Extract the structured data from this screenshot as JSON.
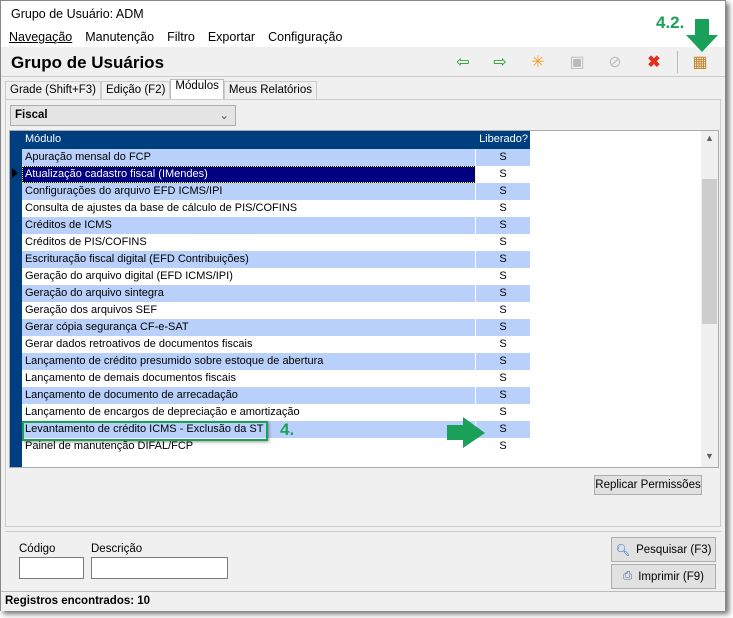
{
  "window": {
    "title": "Grupo de Usuário: ADM"
  },
  "menu": [
    {
      "label": "Navegação"
    },
    {
      "label": "Manutenção"
    },
    {
      "label": "Filtro"
    },
    {
      "label": "Exportar"
    },
    {
      "label": "Configuração"
    }
  ],
  "header": {
    "title": "Grupo de Usuários"
  },
  "toolbar": {
    "icons": [
      "arrow-left-icon",
      "arrow-right-icon",
      "new-icon",
      "save-icon",
      "cancel-icon",
      "delete-icon",
      "exit-icon"
    ]
  },
  "tabs": [
    {
      "label": "Grade (Shift+F3)"
    },
    {
      "label": "Edição (F2)"
    },
    {
      "label": "Módulos",
      "active": true
    },
    {
      "label": "Meus Relatórios"
    }
  ],
  "module_select": {
    "value": "Fiscal"
  },
  "grid": {
    "columns": [
      "Módulo",
      "Liberado?"
    ],
    "rows": [
      [
        "Apuração mensal do FCP",
        "S"
      ],
      [
        "Atualização cadastro fiscal (IMendes)",
        "S"
      ],
      [
        "Configurações do arquivo EFD ICMS/IPI",
        "S"
      ],
      [
        "Consulta de ajustes da base de cálculo de PIS/COFINS",
        "S"
      ],
      [
        "Créditos de ICMS",
        "S"
      ],
      [
        "Créditos de PIS/COFINS",
        "S"
      ],
      [
        "Escrituração fiscal digital (EFD Contribuições)",
        "S"
      ],
      [
        "Geração do arquivo digital (EFD ICMS/IPI)",
        "S"
      ],
      [
        "Geração do arquivo sintegra",
        "S"
      ],
      [
        "Geração dos arquivos SEF",
        "S"
      ],
      [
        "Gerar cópia segurança CF-e-SAT",
        "S"
      ],
      [
        "Gerar dados retroativos de documentos fiscais",
        "S"
      ],
      [
        "Lançamento de crédito presumido sobre estoque de abertura",
        "S"
      ],
      [
        "Lançamento de demais documentos fiscais",
        "S"
      ],
      [
        "Lançamento de documento de arrecadação",
        "S"
      ],
      [
        "Lançamento de encargos de depreciação e amortização",
        "S"
      ],
      [
        "Levantamento de crédito ICMS - Exclusão da ST",
        "S"
      ],
      [
        "Painel de manutenção DIFAL/FCP",
        "S"
      ]
    ],
    "selected_row": 1
  },
  "replicar_label": "Replicar Permissões",
  "filter": {
    "codigo_label": "Código",
    "codigo_value": "",
    "descricao_label": "Descrição",
    "descricao_value": ""
  },
  "buttons": {
    "pesquisar": "Pesquisar (F3)",
    "imprimir": "Imprimir (F9)"
  },
  "status": "Registros encontrados: 10",
  "annotations": {
    "step_4": "4.",
    "step_4_2": "4.2."
  },
  "colors": {
    "grid_header": "#003f7f",
    "row_alt": "#b9d1fa",
    "selected": "#000080",
    "annotation": "#1ba05a"
  }
}
